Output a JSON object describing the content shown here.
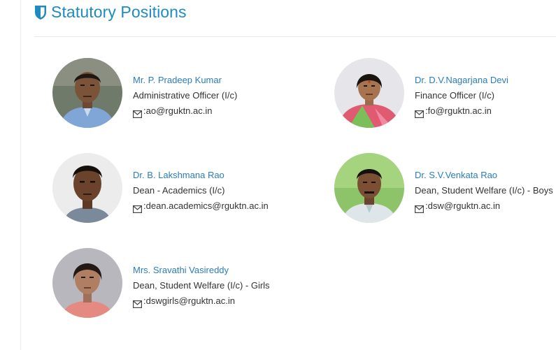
{
  "section": {
    "title": "Statutory Positions",
    "icon": "shield-icon",
    "accent_color": "#1f8bbf"
  },
  "people": [
    {
      "name": "Mr. P. Pradeep Kumar",
      "role": "Administrative Officer (I/c)",
      "email_prefix": ": ",
      "email": "ao@rguktn.ac.in",
      "photo": "portrait-photo"
    },
    {
      "name": "Dr. D.V.Nagarjana Devi",
      "role": "Finance Officer (I/c)",
      "email_prefix": ": ",
      "email": "fo@rguktn.ac.in",
      "photo": "portrait-photo"
    },
    {
      "name": "Dr. B. Lakshmana Rao",
      "role": "Dean - Academics (I/c)",
      "email_prefix": ": ",
      "email": "dean.academics@rguktn.ac.in",
      "photo": "portrait-photo"
    },
    {
      "name": "Dr. S.V.Venkata Rao",
      "role": "Dean, Student Welfare (I/c) - Boys",
      "email_prefix": ": ",
      "email": "dsw@rguktn.ac.in",
      "photo": "portrait-photo"
    },
    {
      "name": "Mrs. Sravathi Vasireddy",
      "role": "Dean, Student Welfare (I/c) - Girls",
      "email_prefix": ": ",
      "email": "dswgirls@rguktn.ac.in",
      "photo": "portrait-photo"
    }
  ]
}
